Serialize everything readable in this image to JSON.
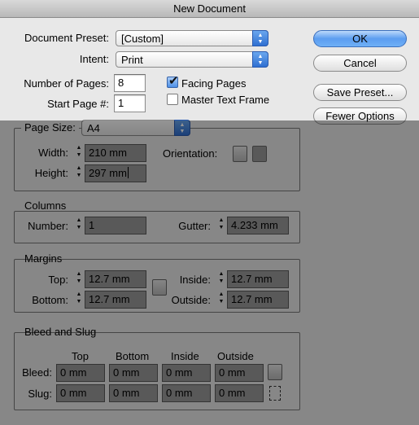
{
  "window": {
    "title": "New Document"
  },
  "document_preset": {
    "label": "Document Preset:",
    "value": "[Custom]"
  },
  "intent": {
    "label": "Intent:",
    "value": "Print"
  },
  "pages": {
    "number_label": "Number of Pages:",
    "number_value": "8",
    "start_label": "Start Page #:",
    "start_value": "1"
  },
  "options": {
    "facing_pages": {
      "label": "Facing Pages",
      "checked": true
    },
    "master_text_frame": {
      "label": "Master Text Frame",
      "checked": false
    }
  },
  "buttons": {
    "ok": "OK",
    "cancel": "Cancel",
    "save_preset": "Save Preset...",
    "fewer_options": "Fewer Options"
  },
  "page_size": {
    "label": "Page Size:",
    "value": "A4",
    "width_label": "Width:",
    "width_value": "210 mm",
    "height_label": "Height:",
    "height_value": "297 mm",
    "orientation_label": "Orientation:"
  },
  "columns": {
    "title": "Columns",
    "number_label": "Number:",
    "number_value": "1",
    "gutter_label": "Gutter:",
    "gutter_value": "4.233 mm"
  },
  "margins": {
    "title": "Margins",
    "top_label": "Top:",
    "top_value": "12.7 mm",
    "bottom_label": "Bottom:",
    "bottom_value": "12.7 mm",
    "inside_label": "Inside:",
    "inside_value": "12.7 mm",
    "outside_label": "Outside:",
    "outside_value": "12.7 mm"
  },
  "bleed_slug": {
    "title": "Bleed and Slug",
    "col_headers": [
      "Top",
      "Bottom",
      "Inside",
      "Outside"
    ],
    "bleed_label": "Bleed:",
    "slug_label": "Slug:",
    "bleed_values": [
      "0 mm",
      "0 mm",
      "0 mm",
      "0 mm"
    ],
    "slug_values": [
      "0 mm",
      "0 mm",
      "0 mm",
      "0 mm"
    ]
  },
  "colors": {
    "accent": "#4d8fe6",
    "overlay": "#000000"
  }
}
